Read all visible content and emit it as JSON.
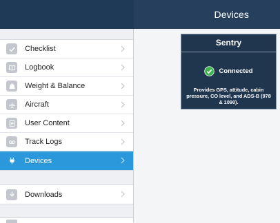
{
  "header": {
    "title": "Devices"
  },
  "sidebar": {
    "items": [
      {
        "label": "Checklist",
        "icon": "checkmark-icon"
      },
      {
        "label": "Logbook",
        "icon": "book-icon"
      },
      {
        "label": "Weight & Balance",
        "icon": "scale-icon"
      },
      {
        "label": "Aircraft",
        "icon": "airplane-icon"
      },
      {
        "label": "User Content",
        "icon": "document-icon"
      },
      {
        "label": "Track Logs",
        "icon": "cassette-icon"
      },
      {
        "label": "Devices",
        "icon": "plug-icon",
        "active": true
      }
    ],
    "downloads": {
      "label": "Downloads",
      "icon": "download-icon"
    }
  },
  "device": {
    "name": "Sentry",
    "status": "Connected",
    "description": "Provides GPS, attitude, cabin pressure, CO level, and ADS-B (978 & 1090)."
  },
  "colors": {
    "topbar": "#253f5c",
    "active_item": "#2c98dc",
    "card_bg": "#20364f",
    "connected_green": "#3fb34f"
  }
}
